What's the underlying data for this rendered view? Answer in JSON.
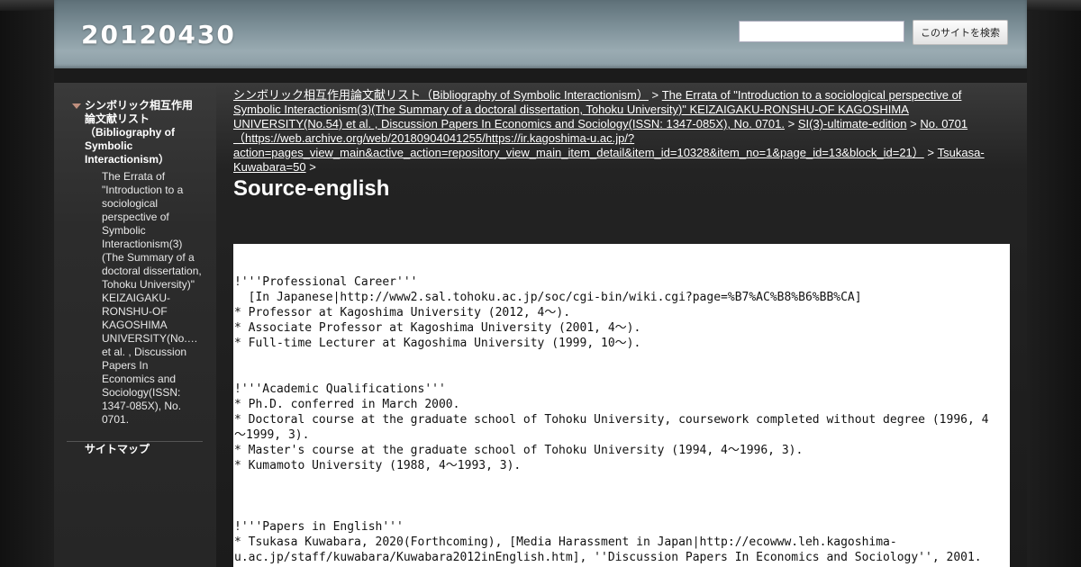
{
  "header": {
    "site_title": "20120430",
    "search_placeholder": "",
    "search_button": "このサイトを検索"
  },
  "sidebar": {
    "main_item": "シンボリック相互作用論文献リスト（Bibliography of Symbolic Interactionism）",
    "sub_item": "The Errata of \"Introduction to a sociological perspective of Symbolic Interactionism(3)(The Summary of a doctoral dissertation, Tohoku University)\" KEIZAIGAKU-RONSHU-OF KAGOSHIMA UNIVERSITY(No.… et al. , Discussion Papers In Economics and Sociology(ISSN: 1347-085X), No. 0701.",
    "sitemap": "サイトマップ"
  },
  "breadcrumb": {
    "items": [
      "シンボリック相互作用論文献リスト（Bibliography of Symbolic Interactionism）",
      "The Errata of \"Introduction to a sociological perspective of Symbolic Interactionism(3)(The Summary of a doctoral dissertation, Tohoku University)\" KEIZAIGAKU-RONSHU-OF KAGOSHIMA UNIVERSITY(No.54) et al. , Discussion Papers In Economics and Sociology(ISSN: 1347-085X), No. 0701.",
      "SI(3)-ultimate-edition",
      "No. 0701（https://web.archive.org/web/20180904041255/https://ir.kagoshima-u.ac.jp/?action=pages_view_main&active_action=repository_view_main_item_detail&item_id=10328&item_no=1&page_id=13&block_id=21）",
      "Tsukasa-Kuwabara=50"
    ],
    "separator": ">"
  },
  "page_title": "Source-english",
  "content_lines": [
    "",
    "",
    "!'''Professional Career'''",
    "  [In Japanese|http://www2.sal.tohoku.ac.jp/soc/cgi-bin/wiki.cgi?page=%B7%AC%B8%B6%BB%CA]",
    "* Professor at Kagoshima University (2012, 4～).",
    "* Associate Professor at Kagoshima University (2001, 4～).",
    "* Full-time Lecturer at Kagoshima University (1999, 10～).",
    "",
    "",
    "!'''Academic Qualifications'''",
    "* Ph.D. conferred in March 2000.",
    "* Doctoral course at the graduate school of Tohoku University, coursework completed without degree (1996, 4",
    "～1999, 3).",
    "* Master's course at the graduate school of Tohoku University (1994, 4～1996, 3).",
    "* Kumamoto University (1988, 4～1993, 3).",
    "",
    "",
    "",
    "!'''Papers in English'''",
    "* Tsukasa Kuwabara, 2020(Forthcoming), [Media Harassment in Japan|http://ecowww.leh.kagoshima-",
    "u.ac.jp/staff/kuwabara/Kuwabara2012inEnglish.htm], ''Discussion Papers In Economics and Sociology'', 2001."
  ],
  "colors": {
    "background": "#1b1b1b",
    "header": "#8a9ca4",
    "arrow": "#c0907f",
    "content_bg": "#ffffff"
  }
}
